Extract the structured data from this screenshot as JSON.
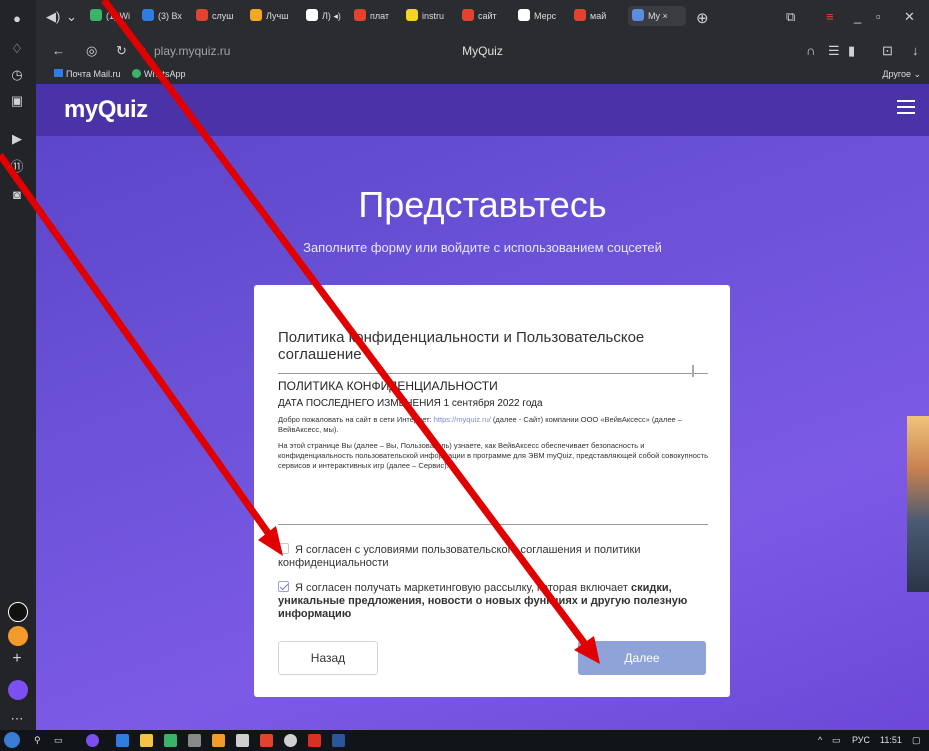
{
  "browser": {
    "tabs": [
      {
        "label": "(1) Wi",
        "color": "#3bb46b"
      },
      {
        "label": "(3) Вх",
        "color": "#2f7de1"
      },
      {
        "label": "слуш",
        "color": "#e0442f"
      },
      {
        "label": "Лучш",
        "color": "#f5a623"
      },
      {
        "label": "Л) ◂)",
        "color": "#ffffff"
      },
      {
        "label": "плат",
        "color": "#e0442f"
      },
      {
        "label": "instru",
        "color": "#f5d327"
      },
      {
        "label": "сайт",
        "color": "#e0442f"
      },
      {
        "label": "Мерс",
        "color": "#ffffff"
      },
      {
        "label": "май",
        "color": "#e0442f"
      },
      {
        "label": "My ×",
        "color": "#5a8de0"
      }
    ],
    "url": "play.myquiz.ru",
    "page_title": "MyQuiz",
    "bookmarks": [
      {
        "label": "Почта Mail.ru"
      },
      {
        "label": "WhatsApp"
      }
    ],
    "bookmarks_other": "Другое ⌄"
  },
  "site": {
    "logo": "myQuiz",
    "title": "Представьтесь",
    "subtitle": "Заполните форму или войдите с использованием соцсетей"
  },
  "card": {
    "title": "Политика конфиденциальности и Пользовательское соглашение",
    "policy_heading": "ПОЛИТИКА КОНФИДЕНЦИАЛЬНОСТИ",
    "policy_date": "ДАТА ПОСЛЕДНЕГО ИЗМЕНЕНИЯ 1 сентября 2022 года",
    "policy_p1_start": "Добро пожаловать на сайт в сети Интернет: ",
    "policy_p1_link": "https://myquiz.ru/",
    "policy_p1_end": " (далее - Сайт) компании ООО «ВейвАксесс» (далее – ВейвАксесс, мы).",
    "policy_p2": "На этой странице Вы (далее – Вы, Пользователь) узнаете, как ВейвАксесс обеспечивает безопасность и конфиденциальность пользовательской информации в программе для ЭВМ myQuiz, представляющей собой совокупность сервисов и интерактивных игр (далее – Сервис).",
    "agree_terms": "Я согласен с условиями пользовательского соглашения и политики конфиденциальности",
    "agree_terms_checked": false,
    "agree_marketing_start": "Я согласен получать маркетинговую рассылку, которая включает ",
    "agree_marketing_bold": "скидки, уникальные предложения, новости о новых функциях и другую полезную информацию",
    "agree_marketing_checked": true,
    "back_label": "Назад",
    "next_label": "Далее"
  },
  "taskbar": {
    "lang": "РУС",
    "time": "11:51"
  },
  "colors": {
    "accent": "#6a51d6",
    "next_button": "#8fa3d8",
    "annotation_arrow": "#e00000"
  }
}
